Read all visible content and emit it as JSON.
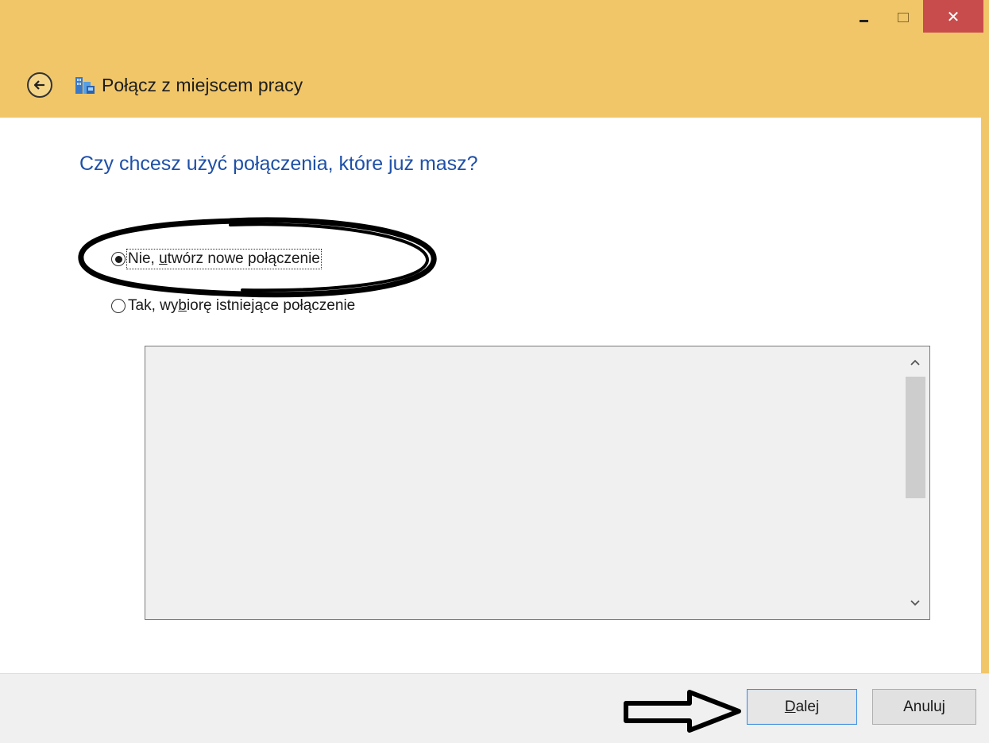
{
  "window": {
    "controls": {
      "minimize_icon": "minimize-icon",
      "maximize_icon": "maximize-icon",
      "close_icon": "close-icon",
      "close_glyph": "✕"
    },
    "title": "Połącz z miejscem pracy",
    "colors": {
      "titlebar": "#f0c669",
      "close_button": "#c94c4c",
      "question_text": "#1e50a8",
      "footer": "#f0f0f0",
      "default_button_border": "#3c8ee0"
    }
  },
  "main": {
    "question": "Czy chcesz użyć połączenia, które już masz?",
    "options": [
      {
        "label_pre": "Nie, ",
        "label_accel": "u",
        "label_post": "twórz nowe połączenie",
        "selected": true
      },
      {
        "label_pre": "Tak, wy",
        "label_accel": "b",
        "label_post": "iorę istniejące połączenie",
        "selected": false
      }
    ],
    "connections_list": []
  },
  "footer": {
    "next_accel": "D",
    "next_rest": "alej",
    "cancel_label": "Anuluj"
  }
}
